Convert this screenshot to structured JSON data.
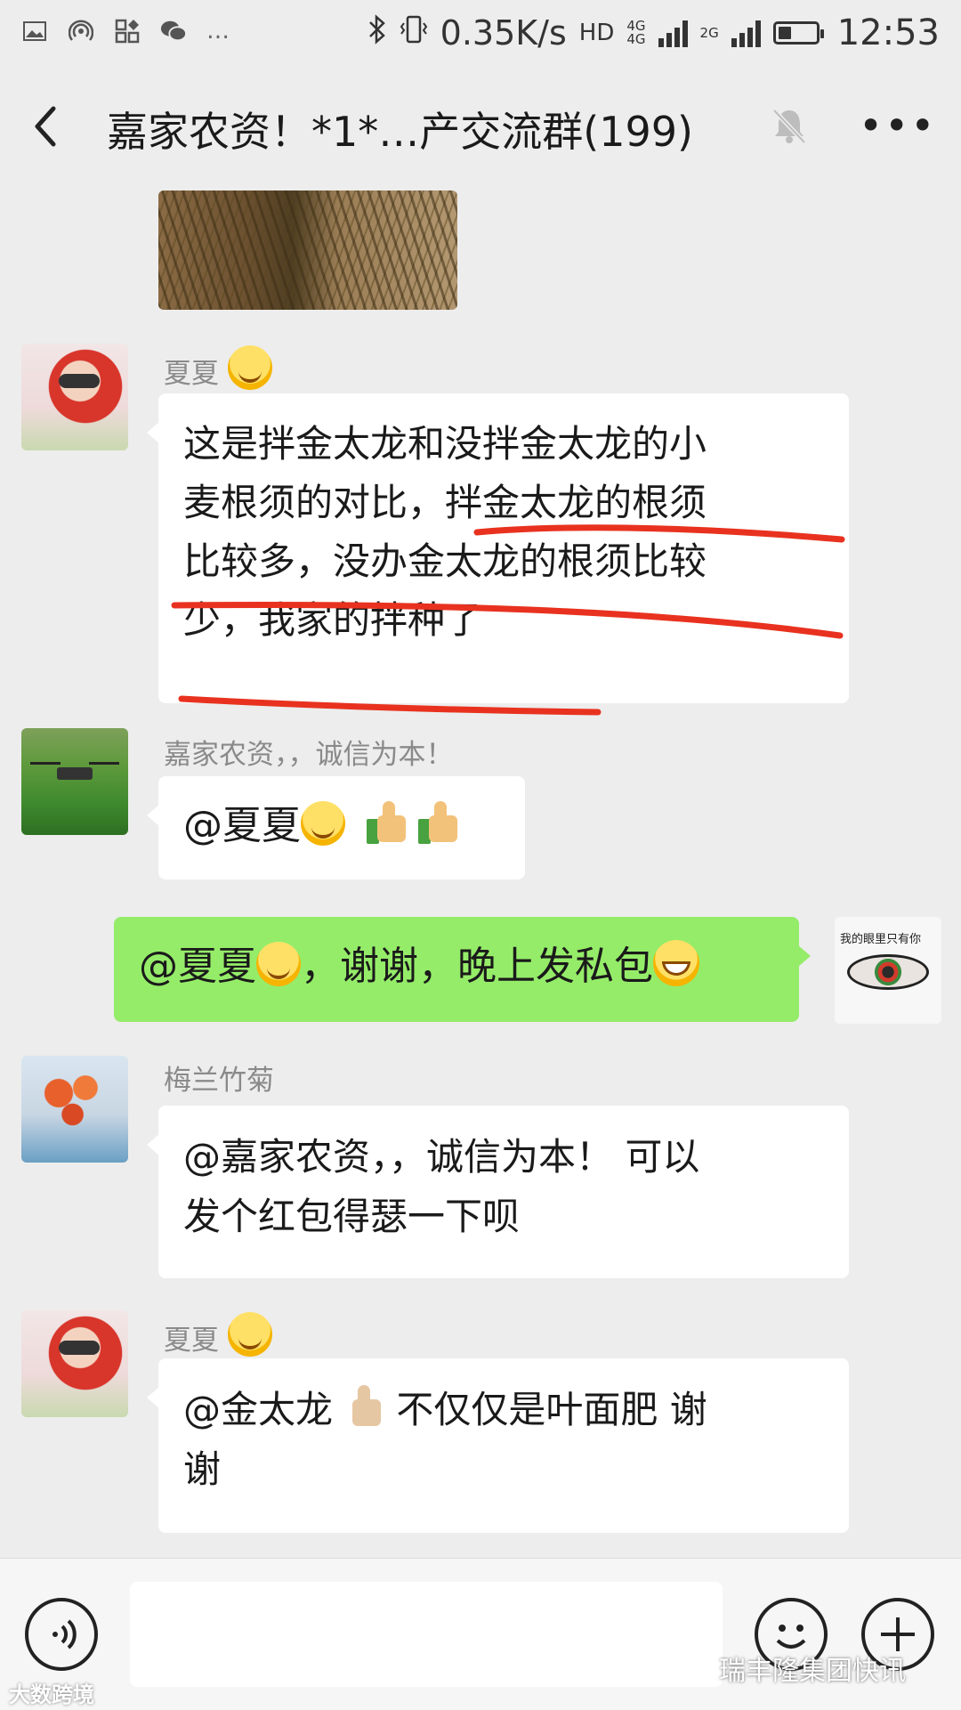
{
  "status_bar": {
    "network_speed": "0.35K/s",
    "hd_label": "HD",
    "net1": "4G",
    "net2": "4G",
    "net3": "2G",
    "battery_level": 0.35,
    "time": "12:53",
    "more_dots": "…"
  },
  "header": {
    "title": "嘉家农资！*1*…产交流群(199)",
    "more": "•••"
  },
  "messages": [
    {
      "sender": "夏夏",
      "text_before_lines": "这是拌金太龙和没拌金太龙的小",
      "line2": "麦根须的对比，拌金太龙的根须",
      "line3": "比较多，没办金太龙的根须比较",
      "line4": "少，我家的拌种了"
    },
    {
      "sender": "嘉家农资，，诚信为本！",
      "text": "@夏夏"
    },
    {
      "text_a": "@夏夏",
      "text_b": "，谢谢，晚上发私包"
    },
    {
      "sender": "梅兰竹菊",
      "line1": "@嘉家农资，，诚信为本！  可以",
      "line2": "发个红包得瑟一下呗"
    },
    {
      "sender": "夏夏",
      "text_a": "@金太龙",
      "text_b": "不仅仅是叶面肥  谢",
      "line2": "谢"
    }
  ],
  "self_avatar_caption": "我的眼里只有你",
  "watermark_left": "大数跨境",
  "watermark_right": "瑞丰隆集团快讯",
  "colors": {
    "chat_bg": "#ededed",
    "bubble_in": "#ffffff",
    "bubble_out": "#95ec69",
    "annotation": "#e8321f"
  }
}
